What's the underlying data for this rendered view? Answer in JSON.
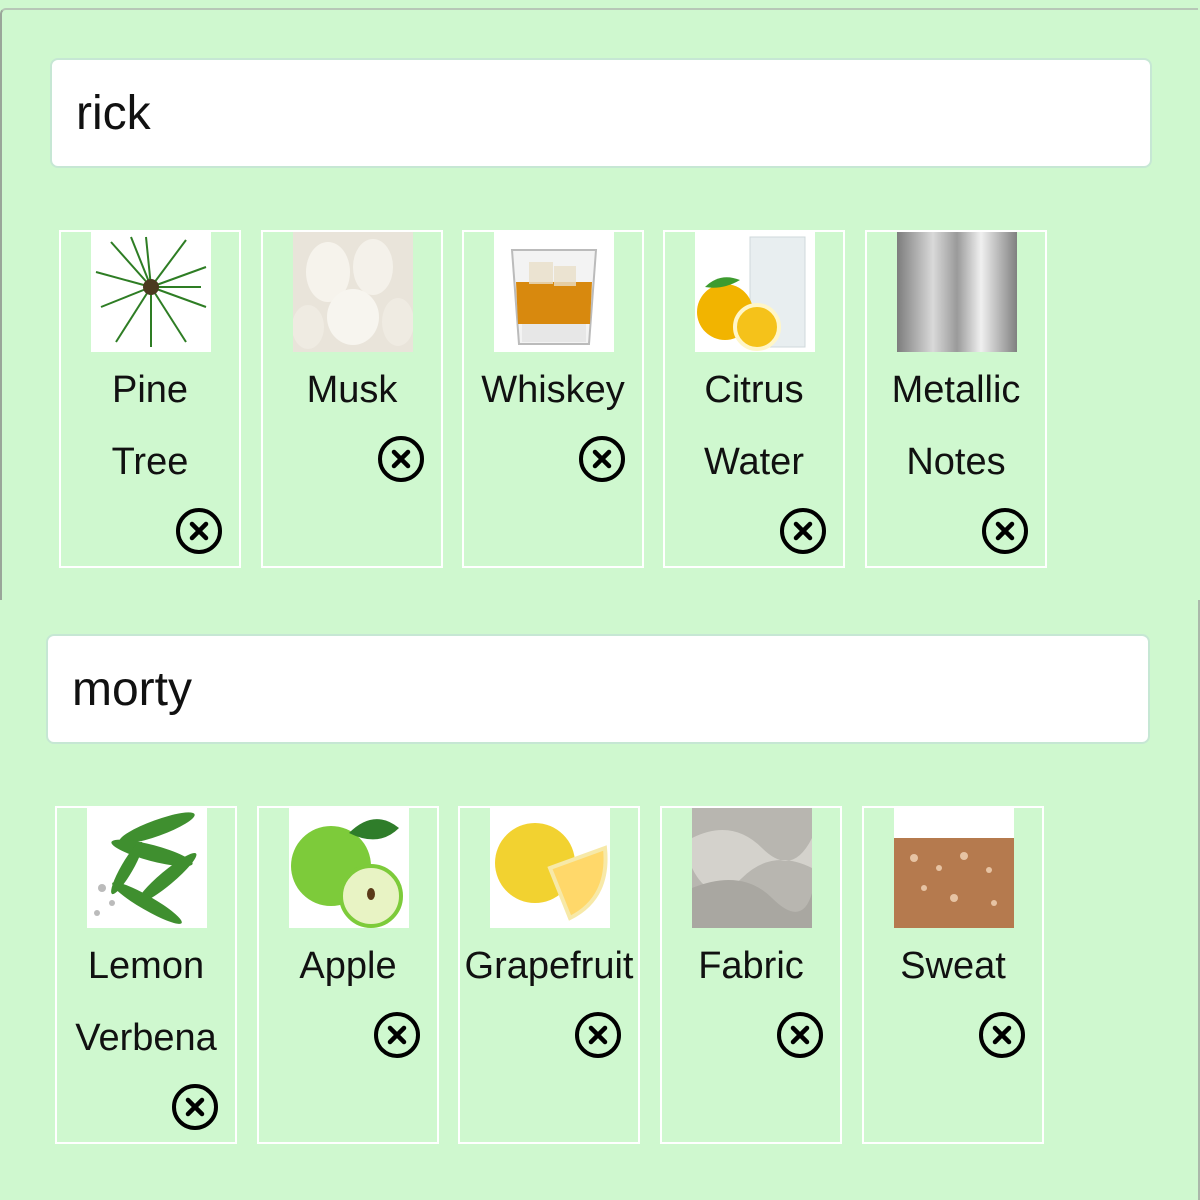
{
  "groups": [
    {
      "name": "rick",
      "notes": [
        {
          "line1": "Pine",
          "line2": "Tree",
          "icon": "pine-tree-image"
        },
        {
          "line1": "Musk",
          "line2": "",
          "icon": "musk-image"
        },
        {
          "line1": "Whiskey",
          "line2": "",
          "icon": "whiskey-image"
        },
        {
          "line1": "Citrus",
          "line2": "Water",
          "icon": "citrus-water-image"
        },
        {
          "line1": "Metallic",
          "line2": "Notes",
          "icon": "metallic-image"
        }
      ]
    },
    {
      "name": "morty",
      "notes": [
        {
          "line1": "Lemon",
          "line2": "Verbena",
          "icon": "lemon-verbena-image"
        },
        {
          "line1": "Apple",
          "line2": "",
          "icon": "apple-image"
        },
        {
          "line1": "Grapefruit",
          "line2": "",
          "icon": "grapefruit-image"
        },
        {
          "line1": "Fabric",
          "line2": "",
          "icon": "fabric-image"
        },
        {
          "line1": "Sweat",
          "line2": "",
          "icon": "sweat-image"
        }
      ]
    }
  ],
  "remove_icon": "close-circle-icon",
  "colors": {
    "background": "#cff8cf",
    "card_border": "#ffffff",
    "input_bg": "#ffffff"
  }
}
